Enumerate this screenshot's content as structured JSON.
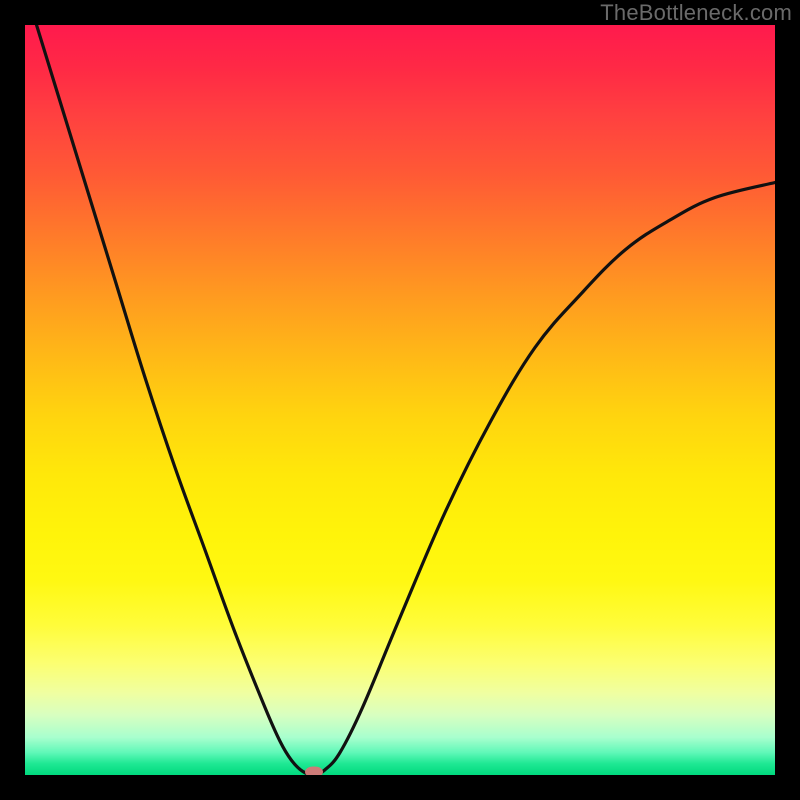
{
  "attribution": "TheBottleneck.com",
  "chart_data": {
    "type": "line",
    "title": "",
    "xlabel": "",
    "ylabel": "",
    "xlim": [
      0,
      100
    ],
    "ylim": [
      0,
      100
    ],
    "series": [
      {
        "name": "bottleneck-curve",
        "x": [
          0,
          4,
          8,
          12,
          16,
          20,
          24,
          28,
          32,
          34,
          35.5,
          37,
          38.5,
          40,
          42,
          45,
          50,
          56,
          62,
          68,
          74,
          80,
          86,
          92,
          100
        ],
        "y": [
          105,
          92,
          79,
          66,
          53,
          41,
          30,
          19,
          9,
          4.5,
          2,
          0.5,
          0,
          0.7,
          3,
          9,
          21,
          35,
          47,
          57,
          64,
          70,
          74,
          77,
          79
        ]
      }
    ],
    "marker": {
      "x": 38.5,
      "y": 0.4,
      "color": "#cd7b78"
    },
    "gradient_colors": {
      "top": "#ff1a4d",
      "upper_mid": "#ff9a20",
      "mid": "#fff40a",
      "lower_mid": "#fcff70",
      "bottom": "#00d97e"
    }
  }
}
